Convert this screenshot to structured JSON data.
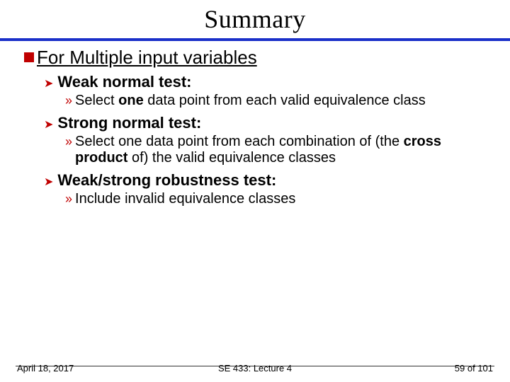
{
  "title": "Summary",
  "heading": "For Multiple input variables",
  "sections": [
    {
      "label": "Weak normal test:",
      "detail_html": "Select <b>one</b> data point from each valid equivalence class"
    },
    {
      "label": "Strong normal test:",
      "detail_html": "Select one data point from each combination of (the <b>cross product</b> of) the valid equivalence classes"
    },
    {
      "label": "Weak/strong robustness test:",
      "detail_html": "Include invalid equivalence classes"
    }
  ],
  "footer": {
    "date": "April 18, 2017",
    "center": "SE 433: Lecture 4",
    "page": "59 of 101"
  },
  "glyphs": {
    "l2_arrow": "➤",
    "l3_raquo": "»"
  }
}
